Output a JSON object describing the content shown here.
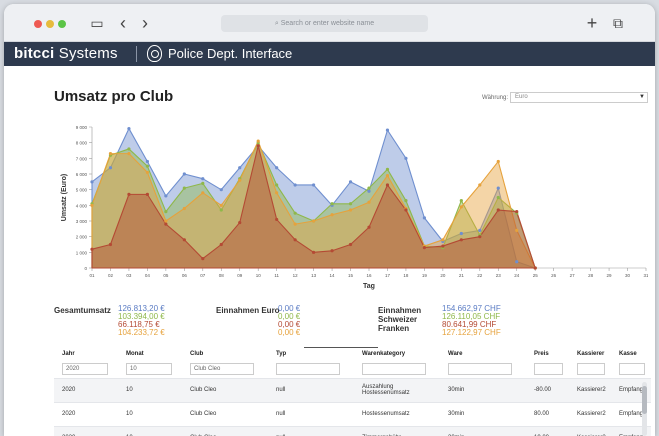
{
  "browser": {
    "address_placeholder": "Search or enter website name",
    "search_glyph": "⌕",
    "back_glyph": "‹",
    "forward_glyph": "›",
    "new_tab_glyph": "+",
    "tabs_glyph": "⧉",
    "sidebar_glyph": "▭"
  },
  "app": {
    "brand_a": "bitcci",
    "brand_b": "Systems",
    "title": "Police Dept. Interface"
  },
  "page": {
    "title": "Umsatz pro Club",
    "currency_label": "Währung:",
    "currency_value": "Euro",
    "select_arrow": "▼"
  },
  "chart_data": {
    "type": "area",
    "xlabel": "Tag",
    "ylabel": "Umsatz (Euro)",
    "ylim": [
      0,
      9000
    ],
    "yticks": [
      0,
      1000,
      2000,
      3000,
      4000,
      5000,
      6000,
      7000,
      8000,
      9000
    ],
    "ytick_labels": [
      "0",
      "1 000",
      "2 000",
      "3 000",
      "4 000",
      "5 000",
      "6 000",
      "7 000",
      "8 000",
      "9 000"
    ],
    "x": [
      "01",
      "02",
      "03",
      "04",
      "05",
      "06",
      "07",
      "08",
      "09",
      "10",
      "11",
      "12",
      "13",
      "14",
      "15",
      "16",
      "17",
      "18",
      "19",
      "20",
      "21",
      "22",
      "23",
      "24",
      "25",
      "26",
      "27",
      "28",
      "29",
      "30",
      "31"
    ],
    "series": [
      {
        "color": "#6f8fcf",
        "values": [
          5500,
          6400,
          8900,
          6800,
          4600,
          6000,
          5700,
          5000,
          6400,
          7800,
          6400,
          5300,
          5300,
          4000,
          5500,
          4900,
          8800,
          7000,
          3200,
          1700,
          2200,
          2400,
          5100,
          400,
          0,
          null,
          null,
          null,
          null,
          null,
          null
        ]
      },
      {
        "color": "#8fb84a",
        "values": [
          4100,
          7200,
          7600,
          6500,
          3600,
          5100,
          5400,
          3700,
          5700,
          8000,
          5300,
          3500,
          3000,
          4100,
          4100,
          5100,
          6300,
          4300,
          1400,
          1300,
          4300,
          2100,
          4500,
          3500,
          0,
          null,
          null,
          null,
          null,
          null,
          null
        ]
      },
      {
        "color": "#e6a23c",
        "values": [
          4000,
          7300,
          7300,
          6100,
          3000,
          3800,
          4800,
          4000,
          5600,
          8100,
          4800,
          2800,
          3000,
          3400,
          3700,
          4200,
          5900,
          3800,
          1400,
          1800,
          3900,
          5300,
          6800,
          2400,
          0,
          null,
          null,
          null,
          null,
          null,
          null
        ]
      },
      {
        "color": "#b44a34",
        "values": [
          1200,
          1500,
          4700,
          4700,
          2800,
          1800,
          600,
          1500,
          2900,
          7800,
          3100,
          1800,
          1000,
          1100,
          1500,
          2600,
          5300,
          3700,
          1300,
          1400,
          1800,
          2000,
          3700,
          3600,
          0,
          null,
          null,
          null,
          null,
          null,
          null
        ]
      }
    ]
  },
  "totals": {
    "gesamt_label": "Gesamtumsatz",
    "gesamt_values": [
      "126.813,20 €",
      "103.394,00 €",
      "66.118,75 €",
      "104.233,72 €"
    ],
    "gesamt_colors": [
      "#5b7cc4",
      "#8fb84a",
      "#b44a34",
      "#e6a23c"
    ],
    "euro_label": "Einnahmen Euro",
    "euro_values": [
      "0,00 €",
      "0,00 €",
      "0,00 €",
      "0,00 €"
    ],
    "euro_colors": [
      "#5b7cc4",
      "#8fb84a",
      "#b44a34",
      "#e6a23c"
    ],
    "chf_label_1": "Einnahmen",
    "chf_label_2": "Schweizer",
    "chf_label_3": "Franken",
    "chf_values": [
      "154.662,97 CHF",
      "126.110,05 CHF",
      "80.641,99 CHF",
      "127.122,97 CHF"
    ],
    "chf_colors": [
      "#5b7cc4",
      "#8fb84a",
      "#b44a34",
      "#e6a23c"
    ]
  },
  "table": {
    "columns": [
      "Jahr",
      "Monat",
      "Club",
      "Typ",
      "Warenkategory",
      "Ware",
      "Preis",
      "Kassierer",
      "Kasse"
    ],
    "filters": [
      "2020",
      "10",
      "Club Cleo",
      "",
      "",
      "",
      "",
      "",
      ""
    ],
    "rows": [
      [
        "2020",
        "10",
        "Club Cleo",
        "null",
        "Auszahlung Hostessenumsatz",
        "30min",
        "-80.00",
        "Kassierer2",
        "Empfang"
      ],
      [
        "2020",
        "10",
        "Club Cleo",
        "null",
        "Hostessenumsatz",
        "30min",
        "80.00",
        "Kassierer2",
        "Empfang"
      ],
      [
        "2020",
        "10",
        "Club Cleo",
        "null",
        "Zimmergebühr",
        "30min",
        "19.00",
        "Kassierer2",
        "Empfang"
      ]
    ]
  }
}
